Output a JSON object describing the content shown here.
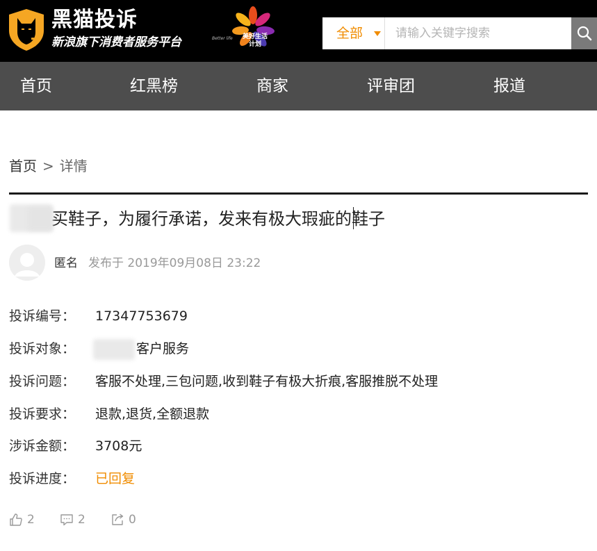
{
  "header": {
    "brand_title": "黑猫投诉",
    "brand_subtitle": "新浪旗下消费者服务平台",
    "campaign_label_line1": "美好生活",
    "campaign_label_line2": "计划",
    "campaign_label_en": "Better life",
    "search": {
      "scope_label": "全部",
      "placeholder": "请输入关键字搜索",
      "value": ""
    }
  },
  "nav": {
    "items": [
      {
        "label": "首页"
      },
      {
        "label": "红黑榜"
      },
      {
        "label": "商家"
      },
      {
        "label": "评审团"
      },
      {
        "label": "报道"
      }
    ]
  },
  "breadcrumb": {
    "home": "首页",
    "separator": ">",
    "current": "详情"
  },
  "complaint": {
    "title": "买鞋子，为履行承诺，发来有极大瑕疵的鞋子",
    "author": "匿名",
    "posted_at": "发布于 2019年09月08日 23:22",
    "details": [
      {
        "label": "投诉编号：",
        "value": "17347753679"
      },
      {
        "label": "投诉对象：",
        "value": "客户服务"
      },
      {
        "label": "投诉问题：",
        "value": "客服不处理,三包问题,收到鞋子有极大折痕,客服推脱不处理"
      },
      {
        "label": "投诉要求：",
        "value": "退款,退货,全额退款"
      },
      {
        "label": "涉诉金额：",
        "value": "3708元"
      },
      {
        "label": "投诉进度：",
        "value": "已回复"
      }
    ]
  },
  "actions": {
    "likes": "2",
    "comments": "2",
    "shares": "0"
  },
  "colors": {
    "header_bg": "#000000",
    "nav_bg": "#4d4d4d",
    "accent": "#f08c00",
    "logo_orange": "#f5a623"
  }
}
